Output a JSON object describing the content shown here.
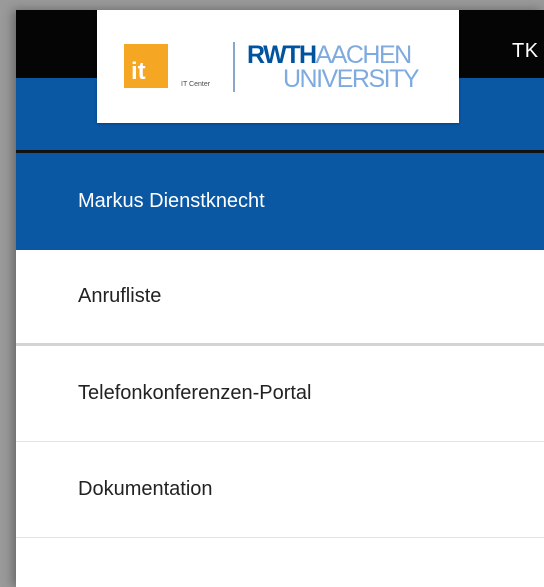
{
  "header": {
    "app_title": "TK",
    "logo": {
      "it_mark": "it",
      "it_subtitle": "IT Center",
      "rwth_bold": "RWTH",
      "rwth_light": "AACHEN",
      "rwth_line2": "UNIVERSITY"
    }
  },
  "nav": {
    "user": "Markus Dienstknecht",
    "items": [
      {
        "label": "Anrufliste"
      },
      {
        "label": "Telefonkonferenzen-Portal"
      },
      {
        "label": "Dokumentation"
      }
    ]
  },
  "colors": {
    "brand_blue": "#0a57a4",
    "logo_orange": "#f5a623",
    "rwth_dark": "#00549f",
    "rwth_light": "#7eaae0",
    "top_bar": "#050505"
  }
}
